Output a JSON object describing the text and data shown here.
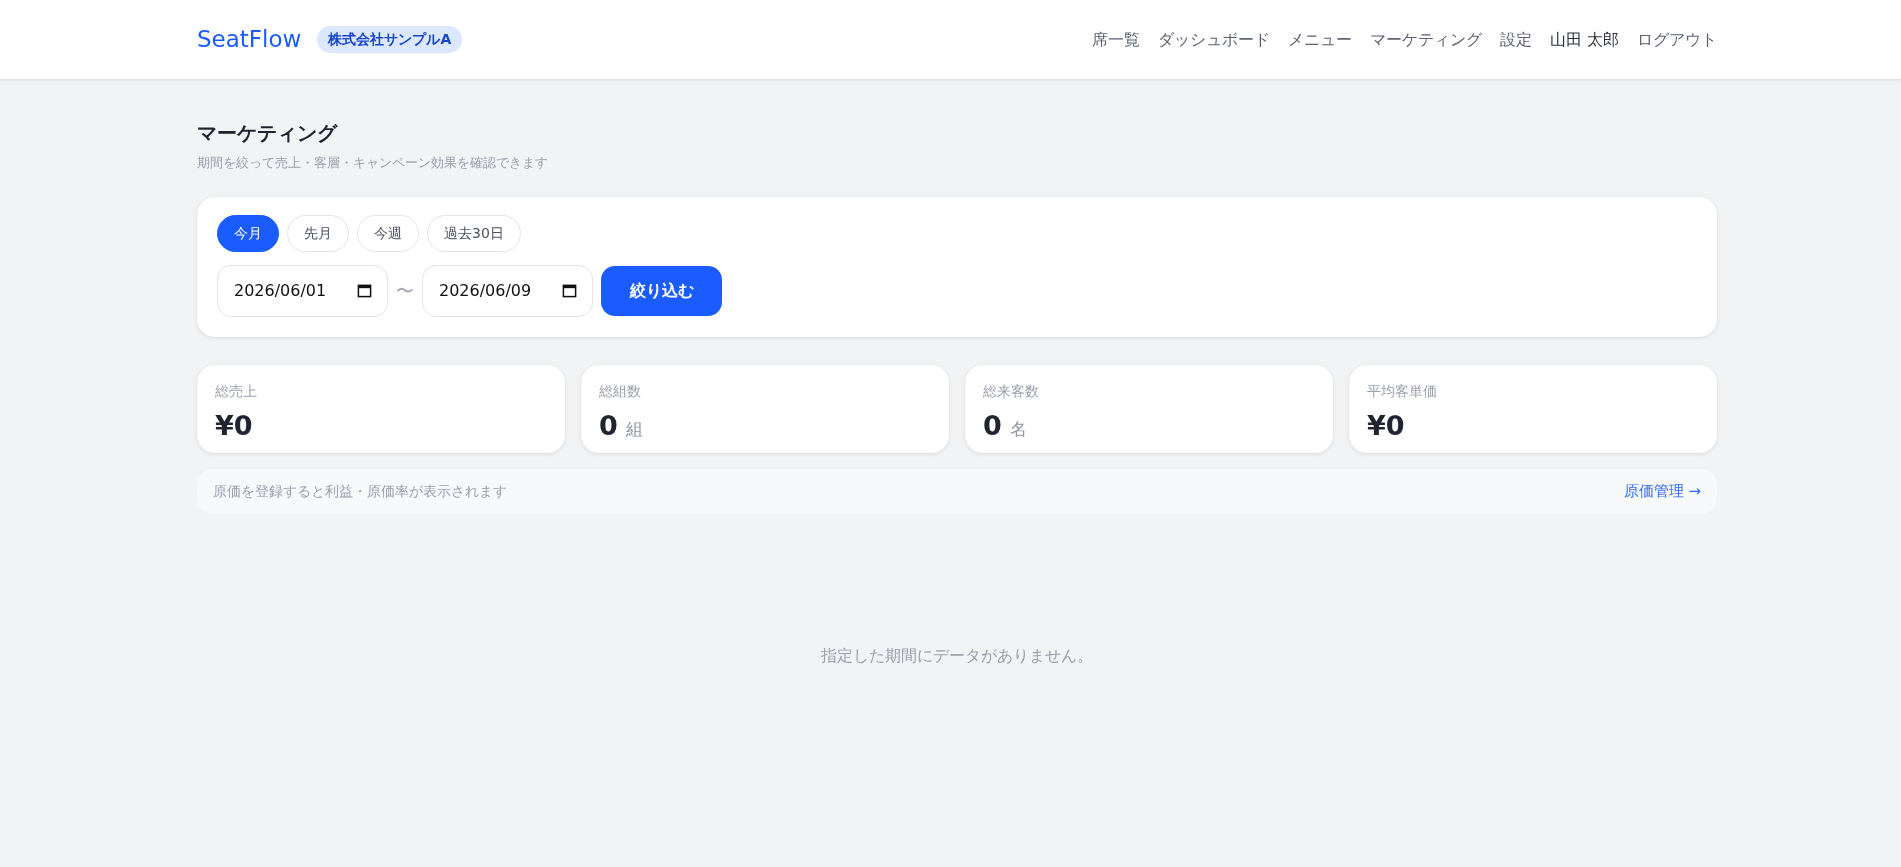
{
  "header": {
    "brand": "SeatFlow",
    "company": "株式会社サンプルA",
    "nav": [
      {
        "label": "席一覧",
        "kind": "link"
      },
      {
        "label": "ダッシュボード",
        "kind": "link"
      },
      {
        "label": "メニュー",
        "kind": "link"
      },
      {
        "label": "マーケティング",
        "kind": "link"
      },
      {
        "label": "設定",
        "kind": "link"
      },
      {
        "label": "山田 太郎",
        "kind": "user"
      },
      {
        "label": "ログアウト",
        "kind": "link"
      }
    ]
  },
  "page": {
    "title": "マーケティング",
    "subtitle": "期間を絞って売上・客層・キャンペーン効果を確認できます"
  },
  "filter": {
    "presets": [
      {
        "label": "今月",
        "selected": true
      },
      {
        "label": "先月",
        "selected": false
      },
      {
        "label": "今週",
        "selected": false
      },
      {
        "label": "過去30日",
        "selected": false
      }
    ],
    "start_date": "2026/06/01",
    "separator": "〜",
    "end_date": "2026/06/09",
    "apply_button": "絞り込む"
  },
  "stats": [
    {
      "label": "総売上",
      "value": "¥0"
    },
    {
      "label": "総組数",
      "value": "0",
      "unit": "組"
    },
    {
      "label": "総来客数",
      "value": "0",
      "unit": "名"
    },
    {
      "label": "平均客単価",
      "value": "¥0"
    }
  ],
  "cost_notice": {
    "text": "原価を登録すると利益・原価率が表示されます",
    "link": "原価管理 →"
  },
  "empty_message": "指定した期間にデータがありません。"
}
